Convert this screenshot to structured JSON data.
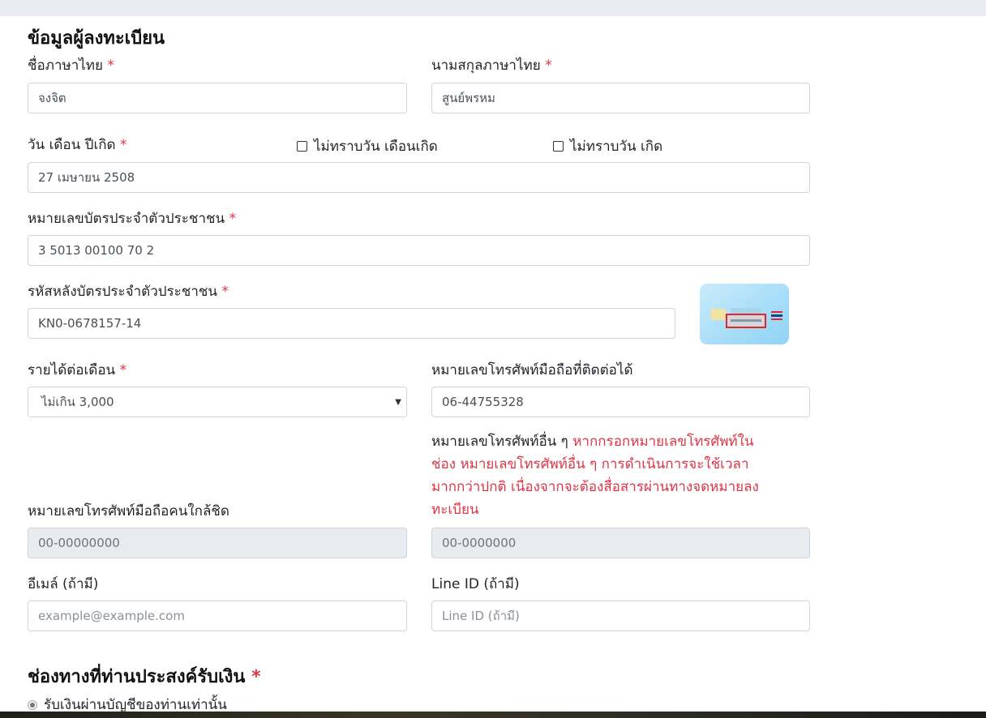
{
  "section": {
    "title": "ข้อมูลผู้ลงทะเบียน",
    "required_mark": "*"
  },
  "first_name": {
    "label": "ชื่อภาษาไทย",
    "value": "จงจิต"
  },
  "last_name": {
    "label": "นามสกุลภาษาไทย",
    "value": "สูนย์พรหม"
  },
  "birth_date": {
    "label": "วัน เดือน ปีเกิด",
    "value": "27 เมษายน 2508",
    "unknown_day_month_label": "ไม่ทราบวัน เดือนเกิด",
    "unknown_day_label": "ไม่ทราบวัน เกิด"
  },
  "id_card": {
    "label": "หมายเลขบัตรประจำตัวประชาชน",
    "value": "3 5013 00100 70 2"
  },
  "laser_code": {
    "label": "รหัสหลังบัตรประจำตัวประชาชน",
    "value": "KN0-0678157-14"
  },
  "income": {
    "label": "รายได้ต่อเดือน",
    "selected": "ไม่เกิน 3,000"
  },
  "mobile": {
    "label": "หมายเลขโทรศัพท์มือถือที่ติดต่อได้",
    "value": "06-44755328"
  },
  "other_phone": {
    "label": "หมายเลขโทรศัพท์อื่น ๆ",
    "warning_1": "หากกรอกหมายเลขโทรศัพท์ใน",
    "warning_2": "ช่อง หมายเลขโทรศัพท์อื่น ๆ การดำเนินการจะใช้เวลา",
    "warning_3": "มากกว่าปกติ เนื่องจากจะต้องสื่อสารผ่านทางจดหมายลง",
    "warning_4": "ทะเบียน",
    "placeholder": "00-0000000"
  },
  "relative_phone": {
    "label": "หมายเลขโทรศัพท์มือถือคนใกล้ชิด",
    "placeholder": "00-00000000"
  },
  "email": {
    "label": "อีเมล์ (ถ้ามี)",
    "placeholder": "example@example.com"
  },
  "line_id": {
    "label": "Line ID (ถ้ามี)",
    "placeholder": "Line ID (ถ้ามี)"
  },
  "payment": {
    "title": "ช่องทางที่ท่านประสงค์รับเงิน",
    "option_1": "รับเงินผ่านบัญชีของท่านเท่านั้น"
  },
  "colors": {
    "required": "#dc3545",
    "border": "#ced4da",
    "disabled_bg": "#e9ecef",
    "topbar": "#e9ecf3"
  },
  "icons": {
    "card_back": "id-card-back-icon",
    "caret": "caret-down-icon",
    "radio": "radio-icon"
  }
}
